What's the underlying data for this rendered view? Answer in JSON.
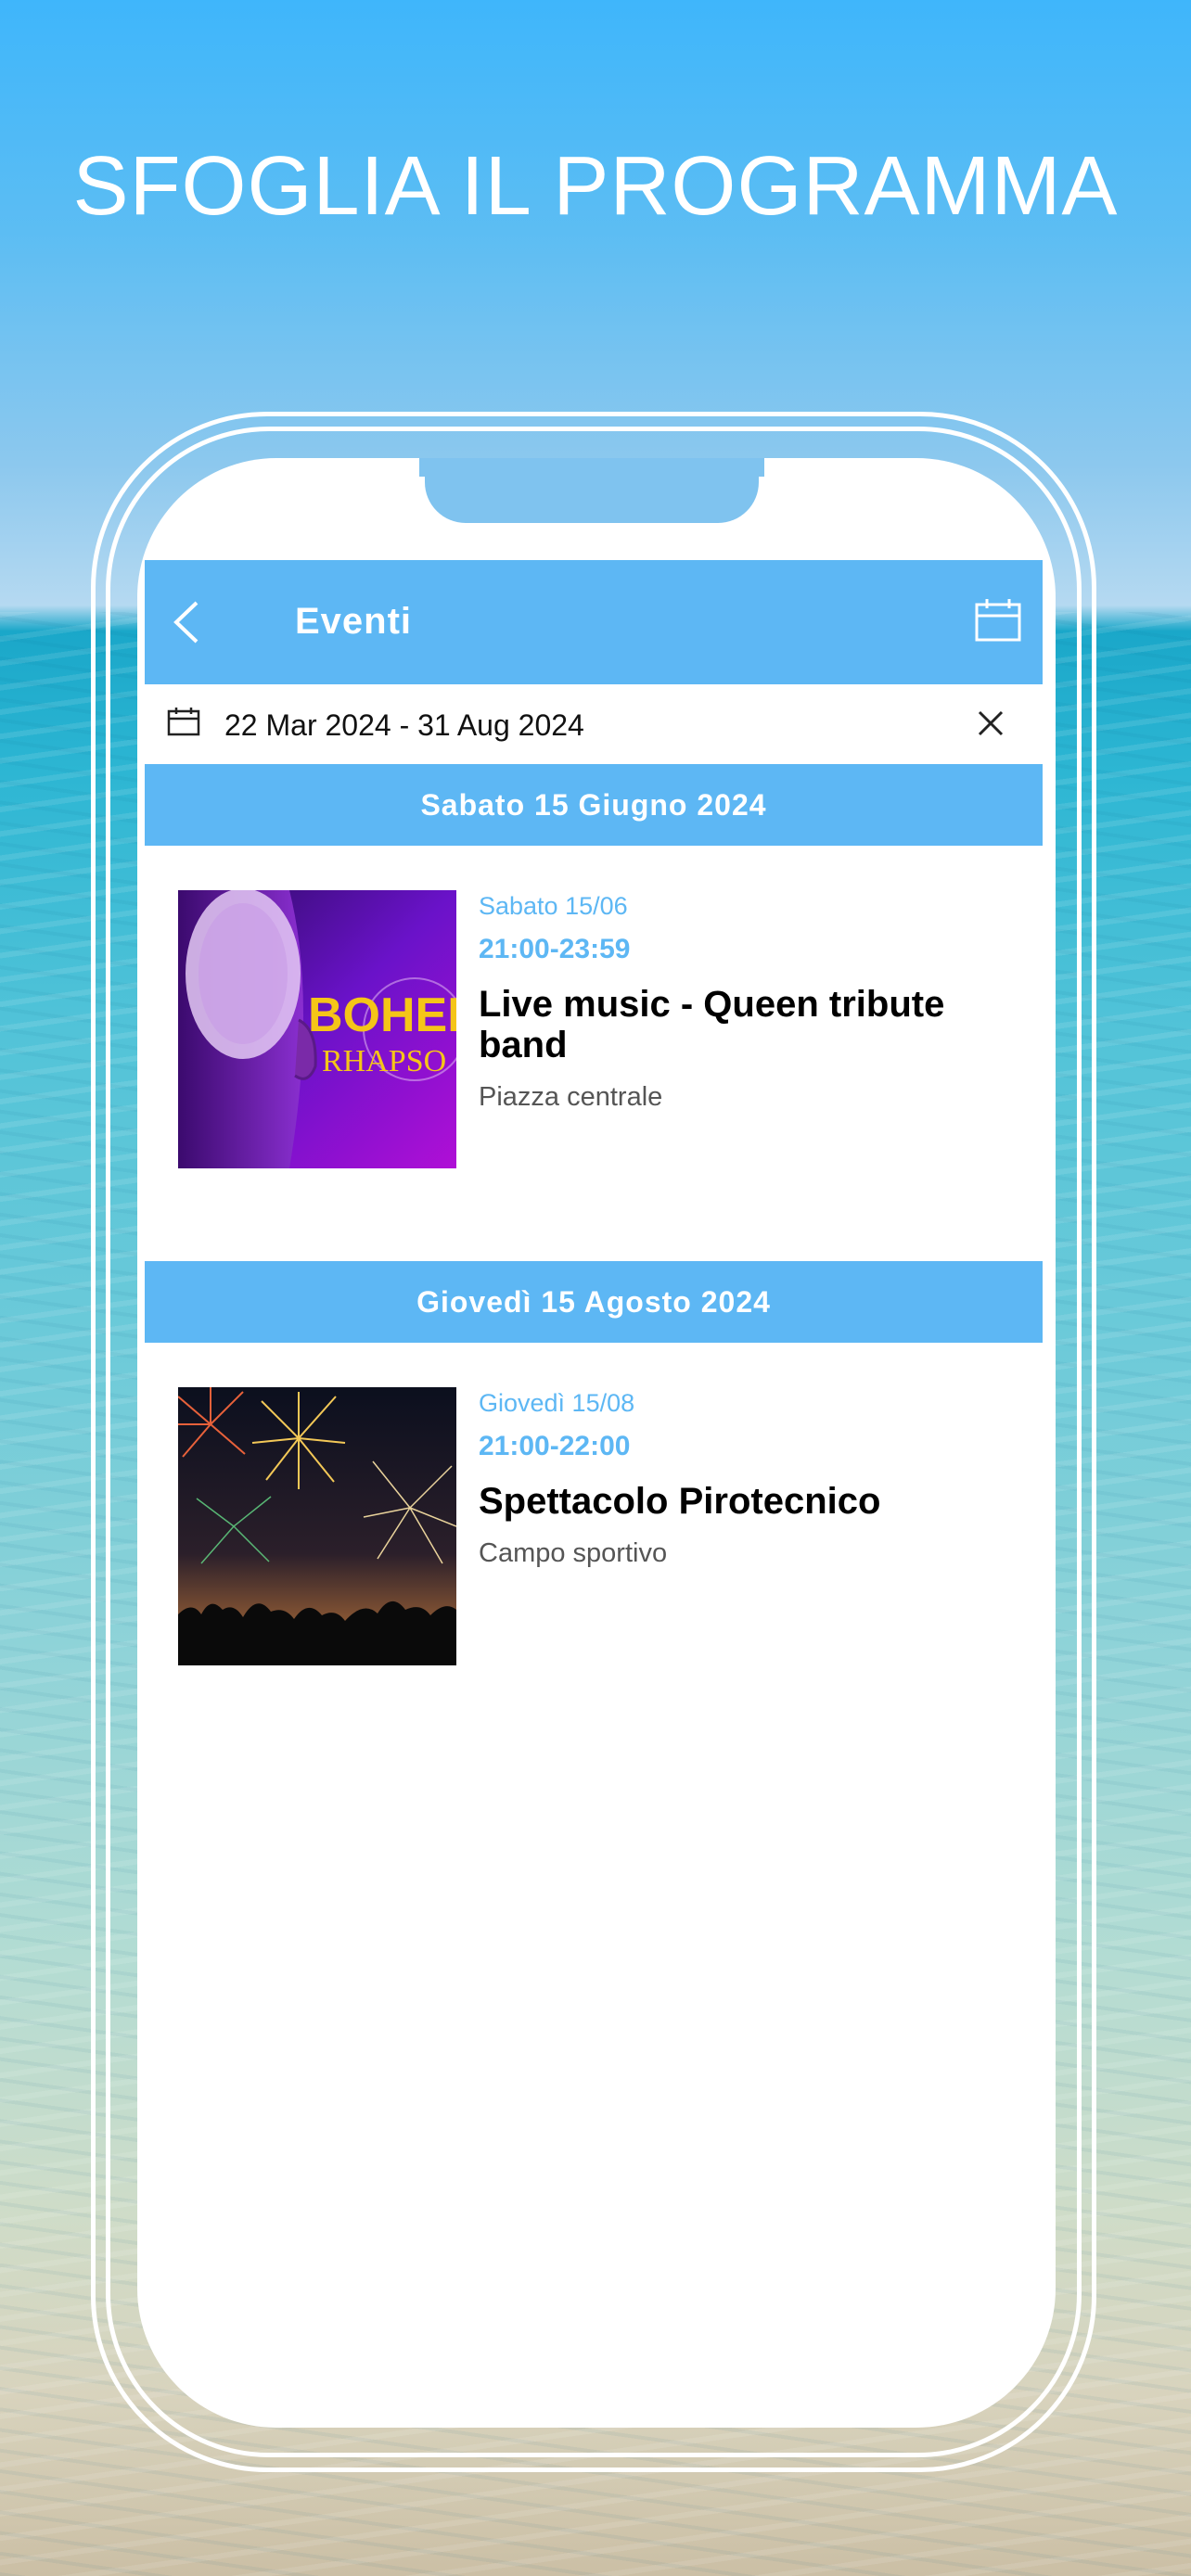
{
  "headline": "SFOGLIA IL PROGRAMMA",
  "app": {
    "title": "Eventi",
    "date_range": "22 Mar 2024 - 31 Aug 2024",
    "accent_color": "#5db7f4"
  },
  "days": [
    {
      "label": "Sabato 15 Giugno 2024",
      "event": {
        "weekday": "Sabato 15/06",
        "time": "21:00-23:59",
        "name": "Live music - Queen tribute band",
        "place": "Piazza centrale",
        "image_text_1": "BOHEMI",
        "image_text_2": "RHAPSO"
      }
    },
    {
      "label": "Giovedì 15 Agosto 2024",
      "event": {
        "weekday": "Giovedì 15/08",
        "time": "21:00-22:00",
        "name": "Spettacolo Pirotecnico",
        "place": "Campo sportivo"
      }
    }
  ]
}
